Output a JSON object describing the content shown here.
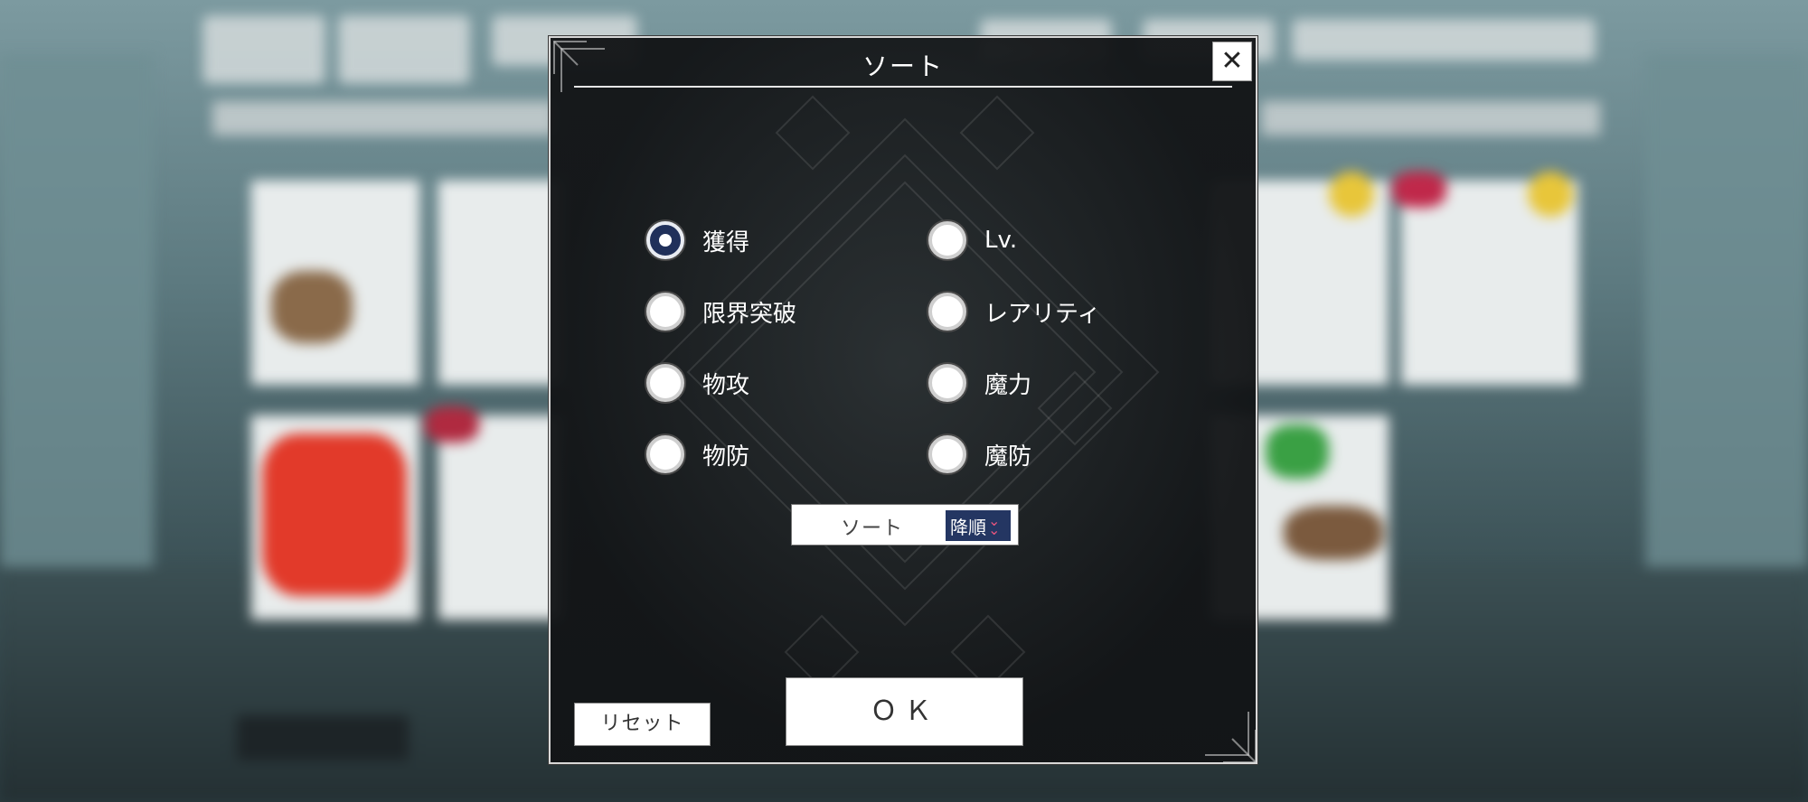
{
  "dialog": {
    "title": "ソート",
    "close_symbol": "✕"
  },
  "options": [
    {
      "id": "acquired",
      "label": "獲得",
      "selected": true
    },
    {
      "id": "level",
      "label": "Lv.",
      "selected": false
    },
    {
      "id": "limit-break",
      "label": "限界突破",
      "selected": false
    },
    {
      "id": "rarity",
      "label": "レアリティ",
      "selected": false
    },
    {
      "id": "phys-atk",
      "label": "物攻",
      "selected": false
    },
    {
      "id": "magic-power",
      "label": "魔力",
      "selected": false
    },
    {
      "id": "phys-def",
      "label": "物防",
      "selected": false
    },
    {
      "id": "magic-def",
      "label": "魔防",
      "selected": false
    }
  ],
  "order": {
    "label": "ソート",
    "value": "降順",
    "icon": "double-chevron-down-icon"
  },
  "buttons": {
    "reset": "リセット",
    "ok": "ＯＫ"
  },
  "colors": {
    "selected_radio": "#20305a",
    "order_toggle": "#243662",
    "chevron": "#e6557e"
  }
}
